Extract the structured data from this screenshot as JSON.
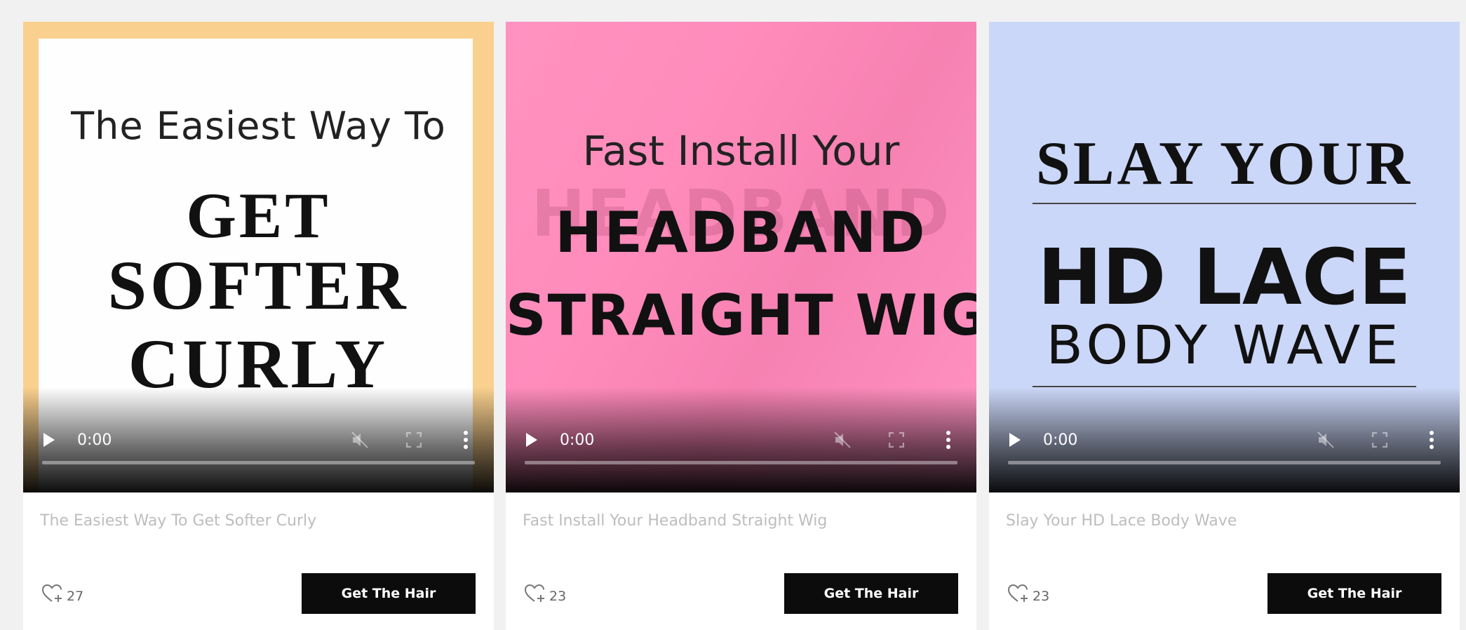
{
  "cards": [
    {
      "poster_lines": [
        "The Easiest Way To",
        "GET",
        "SOFTER",
        "CURLY"
      ],
      "time": "0:00",
      "title": "The Easiest Way To Get Softer Curly",
      "likes": "27",
      "button": "Get The Hair"
    },
    {
      "poster_lines": [
        "Fast Install Your",
        "HEADBAND",
        "STRAIGHT WIG"
      ],
      "time": "0:00",
      "title": "Fast Install Your Headband Straight Wig",
      "likes": "23",
      "button": "Get The Hair"
    },
    {
      "poster_lines": [
        "SLAY YOUR",
        "HD LACE",
        "BODY WAVE"
      ],
      "time": "0:00",
      "title": "Slay Your HD Lace Body Wave",
      "likes": "23",
      "button": "Get The Hair"
    }
  ],
  "icons": {
    "play": "play-icon",
    "mute": "muted-speaker-icon",
    "fullscreen": "fullscreen-icon",
    "more": "more-vertical-icon",
    "like": "heart-plus-icon"
  },
  "colors": {
    "card1_poster_bg": "#f9d08e",
    "card2_poster_bg": "#ff8bbb",
    "card3_poster_bg": "#cbd7f8",
    "button_bg": "#0c0c0c",
    "title_text": "#bdbdbd"
  }
}
